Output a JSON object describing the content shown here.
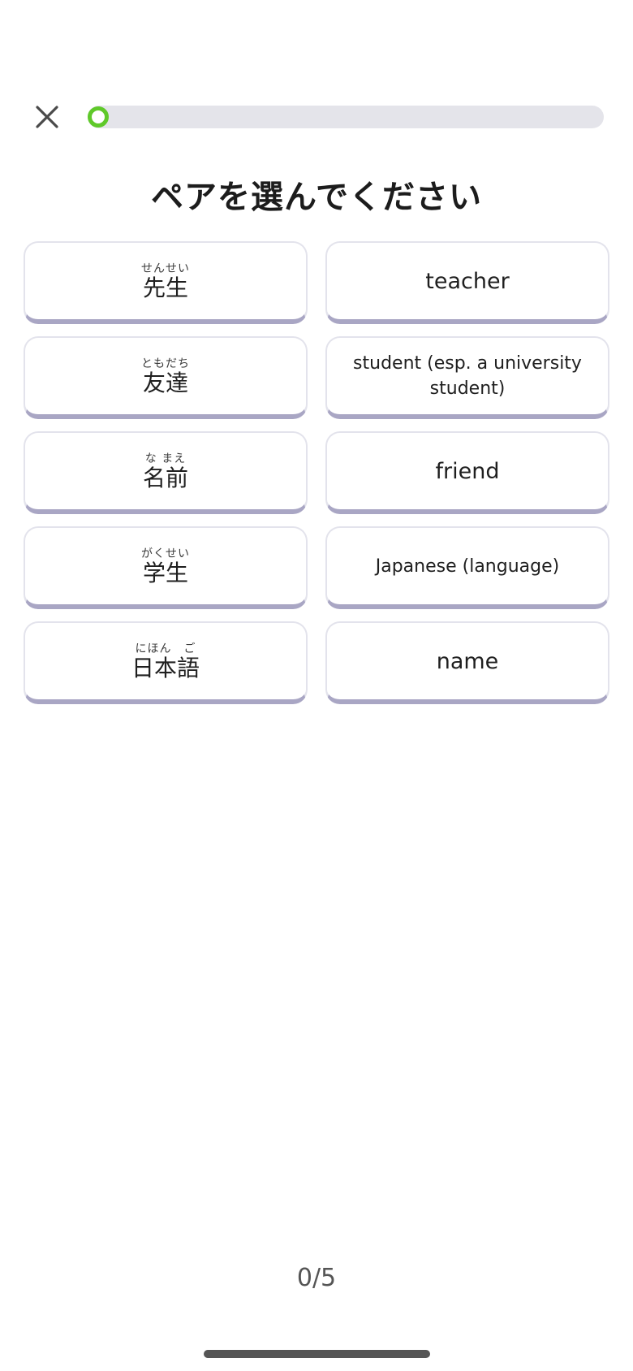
{
  "header": {
    "close_icon": "close-icon",
    "progress": 0,
    "progress_color": "#5fc92a"
  },
  "title": "ペアを選んでください",
  "pairs": {
    "left": [
      {
        "kanji": "先生",
        "furigana": "せんせい"
      },
      {
        "kanji": "友達",
        "furigana": "ともだち"
      },
      {
        "kanji": "名前",
        "furigana": "な まえ"
      },
      {
        "kanji": "学生",
        "furigana": "がくせい"
      },
      {
        "kanji": "日本語",
        "furigana": "にほん　ご"
      }
    ],
    "right": [
      {
        "text": "teacher"
      },
      {
        "text": "student (esp. a university student)"
      },
      {
        "text": "friend"
      },
      {
        "text": "Japanese (language)"
      },
      {
        "text": "name"
      }
    ]
  },
  "counter": "0/5"
}
